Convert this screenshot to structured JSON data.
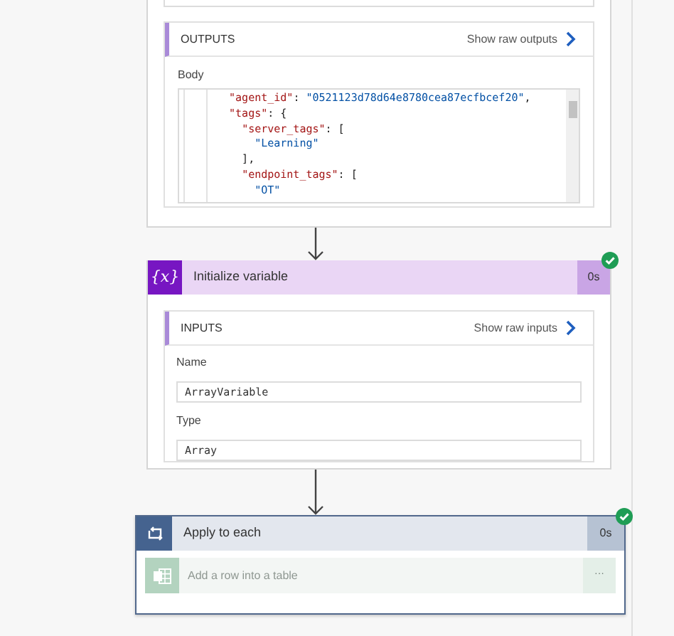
{
  "outputs": {
    "title": "OUTPUTS",
    "link": "Show raw outputs",
    "body_label": "Body",
    "code_lines": [
      "  \"agent_id\": \"0521123d78d64e8780cea87ecfbcef20\",",
      "  \"tags\": {",
      "    \"server_tags\": [",
      "      \"Learning\"",
      "    ],",
      "    \"endpoint_tags\": [",
      "      \"OT\""
    ]
  },
  "init_step": {
    "title": "Initialize variable",
    "icon": "{x}",
    "duration": "0s",
    "succeeded": true,
    "inputs": {
      "title": "INPUTS",
      "link": "Show raw inputs",
      "fields": [
        {
          "label": "Name",
          "value": "ArrayVariable"
        },
        {
          "label": "Type",
          "value": "Array"
        }
      ]
    }
  },
  "loop_step": {
    "title": "Apply to each",
    "duration": "0s",
    "succeeded": true,
    "actions": [
      {
        "title": "Add a row into a table",
        "more": "···",
        "disabled": true
      }
    ]
  }
}
